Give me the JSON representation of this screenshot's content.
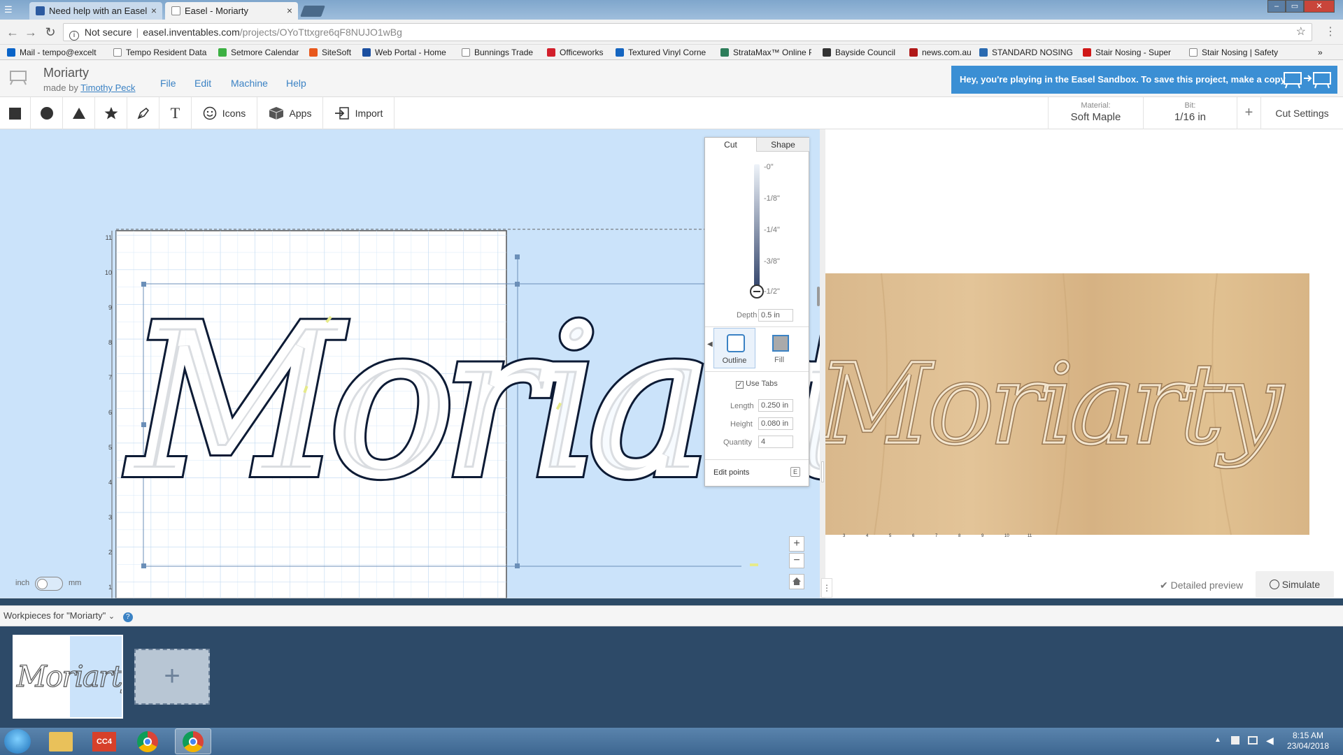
{
  "browser": {
    "tabs": [
      {
        "title": "Need help with an Easel",
        "close": "×"
      },
      {
        "title": "Easel - Moriarty",
        "close": "×"
      }
    ],
    "security": "Not secure",
    "url_host": "easel.inventables.com",
    "url_path": "/projects/OYoTttxgre6qF8NUJO1wBg",
    "window_controls": [
      "–",
      "▭",
      "✕"
    ],
    "bookmarks": [
      {
        "label": "Mail - tempo@excelt",
        "color": "#0a64c8"
      },
      {
        "label": "Tempo Resident Data",
        "color": "#cccccc"
      },
      {
        "label": "Setmore Calendar",
        "color": "#3cb043"
      },
      {
        "label": "SiteSoft",
        "color": "#e8581c"
      },
      {
        "label": "Web Portal - Home",
        "color": "#1b4fa0"
      },
      {
        "label": "Bunnings Trade",
        "color": "#cccccc"
      },
      {
        "label": "Officeworks",
        "color": "#d21f2b"
      },
      {
        "label": "Textured Vinyl Corne",
        "color": "#1565c0"
      },
      {
        "label": "StrataMax™ Online P",
        "color": "#2d7d5a"
      },
      {
        "label": "Bayside Council",
        "color": "#333333"
      },
      {
        "label": "news.com.au",
        "color": "#b01818"
      },
      {
        "label": "STANDARD NOSING",
        "color": "#2a6ab0"
      },
      {
        "label": "Stair Nosing - Super",
        "color": "#d01818"
      },
      {
        "label": "Stair Nosing | Safety",
        "color": "#cccccc"
      }
    ],
    "bookmarks_more": "»"
  },
  "app": {
    "project_title": "Moriarty",
    "made_by": "made by",
    "author": "Timothy Peck",
    "menus": [
      "File",
      "Edit",
      "Machine",
      "Help"
    ],
    "sandbox_banner": "Hey, you're playing in the Easel Sandbox. To save this project, make a copy"
  },
  "tools": {
    "icons_label": "Icons",
    "apps_label": "Apps",
    "import_label": "Import",
    "text_glyph": "T",
    "material_label": "Material:",
    "material_value": "Soft Maple",
    "bit_label": "Bit:",
    "bit_value": "1/16 in",
    "plus": "+",
    "cut_settings": "Cut Settings"
  },
  "design": {
    "text": "Moriarty",
    "y_ruler": [
      "11",
      "10",
      "9",
      "8",
      "7",
      "6",
      "5",
      "4",
      "3",
      "2",
      "1"
    ],
    "units_inch": "inch",
    "units_mm": "mm",
    "zoom_in": "+",
    "zoom_out": "−"
  },
  "cut_panel": {
    "tab_cut": "Cut",
    "tab_shape": "Shape",
    "depth_ticks": [
      "-0\"",
      "-1/8\"",
      "-1/4\"",
      "-3/8\"",
      "-1/2\""
    ],
    "depth_label": "Depth",
    "depth_value": "0.5 in",
    "outline_label": "Outline",
    "fill_label": "Fill",
    "use_tabs_label": "Use Tabs",
    "length_label": "Length",
    "length_value": "0.250 in",
    "height_label": "Height",
    "height_value": "0.080 in",
    "quantity_label": "Quantity",
    "quantity_value": "4",
    "edit_points_label": "Edit points",
    "edit_points_key": "E"
  },
  "preview": {
    "text": "Moriarty",
    "x_ruler": [
      "3",
      "4",
      "5",
      "6",
      "7",
      "8",
      "9",
      "10",
      "11"
    ],
    "detailed_preview": "Detailed preview",
    "simulate": "Simulate"
  },
  "workpieces": {
    "label": "Workpieces for \"Moriarty\"",
    "help": "?",
    "thumb_text": "Moriarty",
    "add": "+"
  },
  "taskbar": {
    "time": "8:15 AM",
    "date": "23/04/2018",
    "cc_label": "CC4"
  }
}
